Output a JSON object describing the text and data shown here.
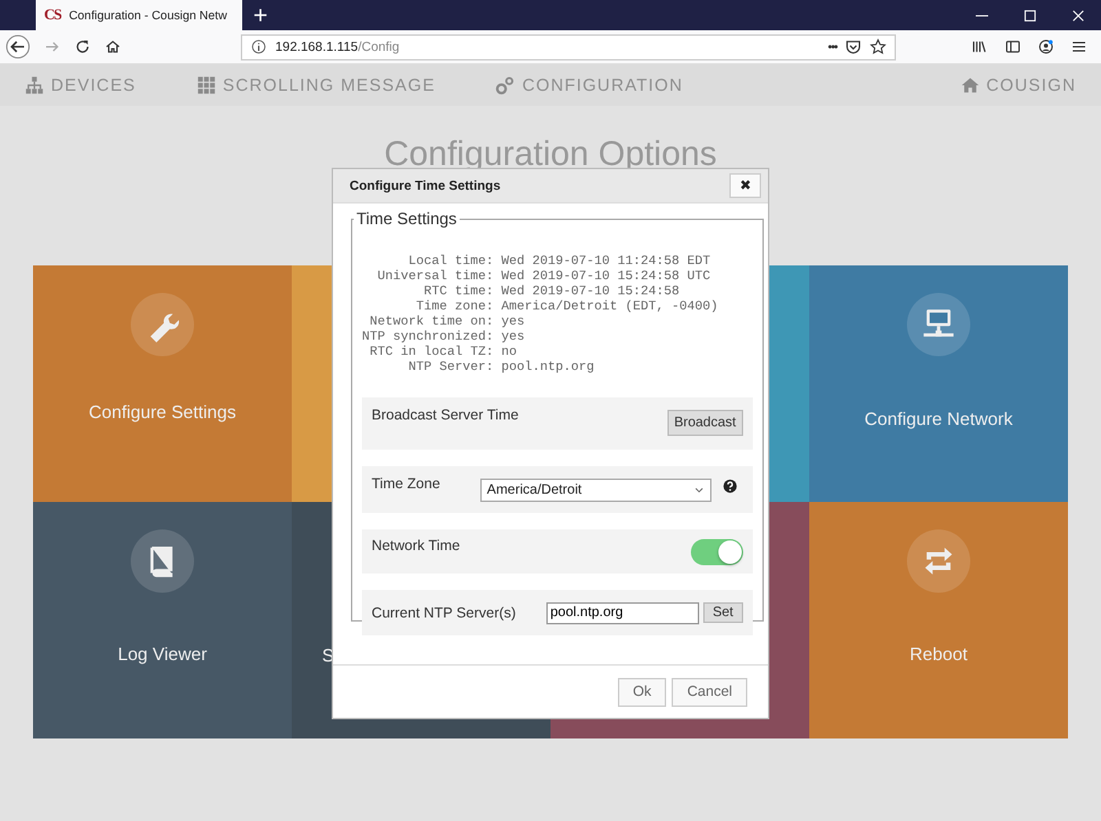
{
  "browser": {
    "favicon": "CS",
    "tab_title": "Configuration - Cousign Netw",
    "new_tab": "+",
    "url_host": "192.168.1.115",
    "url_path": "/Config",
    "page_actions": "•••"
  },
  "nav": {
    "items": [
      {
        "label": "DEVICES"
      },
      {
        "label": "SCROLLING MESSAGE"
      },
      {
        "label": "CONFIGURATION"
      }
    ],
    "brand": {
      "label": "COUSIGN"
    }
  },
  "heading": "Configuration Options",
  "tiles": [
    {
      "label": "Configure Settings",
      "color": "#c47a35"
    },
    {
      "color": "#d89a45"
    },
    {
      "color": "#3e97b5"
    },
    {
      "label": "Configure Network",
      "color": "#3f7ba3"
    },
    {
      "label": "Log Viewer",
      "color": "#475866"
    },
    {
      "label": "S",
      "color": "#3f4d58"
    },
    {
      "color": "#874c5b"
    },
    {
      "label": "Reboot",
      "color": "#c47a35"
    }
  ],
  "modal": {
    "title": "Configure Time Settings",
    "close": "✖",
    "legend": "Time Settings",
    "status_lines": [
      "      Local time: Wed 2019-07-10 11:24:58 EDT",
      "  Universal time: Wed 2019-07-10 15:24:58 UTC",
      "        RTC time: Wed 2019-07-10 15:24:58",
      "       Time zone: America/Detroit (EDT, -0400)",
      " Network time on: yes",
      "NTP synchronized: yes",
      " RTC in local TZ: no",
      "      NTP Server: pool.ntp.org"
    ],
    "rows": [
      {
        "kind": "button",
        "label": "Broadcast Server Time",
        "button": "Broadcast"
      },
      {
        "kind": "select",
        "label": "Time Zone",
        "value": "America/Detroit",
        "help": true
      },
      {
        "kind": "toggle",
        "label": "Network Time",
        "on": true
      },
      {
        "kind": "input",
        "label": "Current NTP Server(s)",
        "value": "pool.ntp.org",
        "button": "Set"
      }
    ],
    "buttons": [
      "Ok",
      "Cancel"
    ]
  }
}
